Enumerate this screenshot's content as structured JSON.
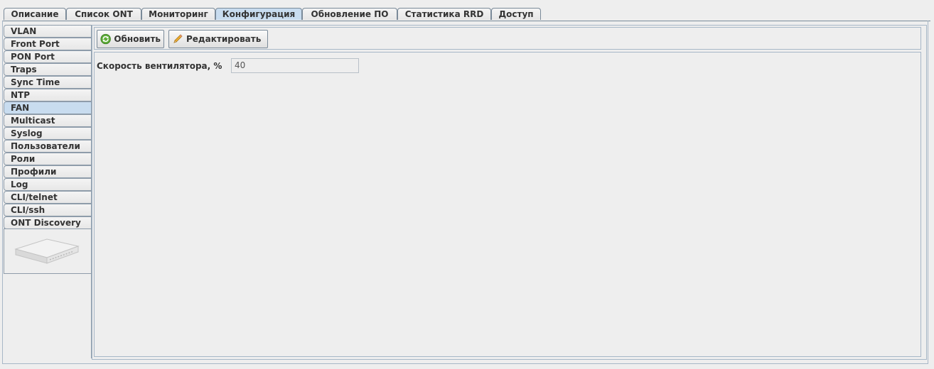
{
  "top_tabs": [
    {
      "label": "Описание",
      "active": false
    },
    {
      "label": "Список ONT",
      "active": false
    },
    {
      "label": "Мониторинг",
      "active": false
    },
    {
      "label": "Конфигурация",
      "active": true
    },
    {
      "label": "Обновление ПО",
      "active": false
    },
    {
      "label": "Статистика RRD",
      "active": false
    },
    {
      "label": "Доступ",
      "active": false
    }
  ],
  "side_tabs": [
    {
      "label": "VLAN",
      "active": false
    },
    {
      "label": "Front Port",
      "active": false
    },
    {
      "label": "PON Port",
      "active": false
    },
    {
      "label": "Traps",
      "active": false
    },
    {
      "label": "Sync Time",
      "active": false
    },
    {
      "label": "NTP",
      "active": false
    },
    {
      "label": "FAN",
      "active": true
    },
    {
      "label": "Multicast",
      "active": false
    },
    {
      "label": "Syslog",
      "active": false
    },
    {
      "label": "Пользователи",
      "active": false
    },
    {
      "label": "Роли",
      "active": false
    },
    {
      "label": "Профили",
      "active": false
    },
    {
      "label": "Log",
      "active": false
    },
    {
      "label": "CLI/telnet",
      "active": false
    },
    {
      "label": "CLI/ssh",
      "active": false
    },
    {
      "label": "ONT Discovery",
      "active": false
    }
  ],
  "toolbar": {
    "refresh_label": "Обновить",
    "refresh_icon": "refresh-icon",
    "edit_label": "Редактировать",
    "edit_icon": "pencil-icon"
  },
  "form": {
    "fan_speed_label": "Скорость вентилятора, %",
    "fan_speed_value": "40"
  },
  "colors": {
    "active_tab": "#c8dcef",
    "border": "#7a8a99"
  }
}
